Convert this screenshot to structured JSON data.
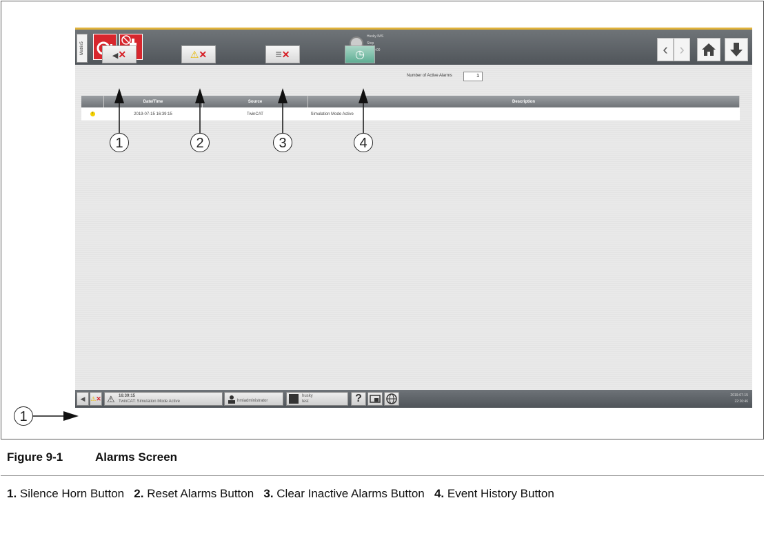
{
  "hmi": {
    "side_tab": "Matrix5",
    "status_lines": [
      "Husky IMS",
      "Stop",
      "00:00:00"
    ],
    "status_unit": "°C",
    "nav": {
      "back": "‹",
      "forward": "›"
    },
    "toolbar": {
      "silence_glyph": "◀",
      "x_glyph": "✕",
      "warn_glyph": "⚠",
      "list_glyph": "≡",
      "history_glyph": "◷",
      "active_alarms_label": "Number of Active Alarms",
      "active_alarms_value": "1"
    },
    "table": {
      "headers": [
        "",
        "Date/Time",
        "Source",
        "Description"
      ],
      "rows": [
        {
          "icon": "!",
          "datetime": "2019-07-15 16:39:15",
          "source": "TwinCAT",
          "description": "Simulation Mode Active"
        }
      ]
    },
    "bottom": {
      "alarm_time": "16:39:15",
      "alarm_text": "TwinCAT: Simulation Mode Active",
      "user": "hmiadministrator",
      "mold_name": "husky",
      "mold_sub": "test",
      "help": "?",
      "date": "2019-07-15",
      "time": "22:26:46"
    }
  },
  "callouts": [
    "1",
    "2",
    "3",
    "4"
  ],
  "bottom_callout": "1",
  "figure": {
    "number": "Figure 9-1",
    "title": "Alarms Screen"
  },
  "legend": [
    {
      "num": "1.",
      "text": "Silence Horn Button"
    },
    {
      "num": "2.",
      "text": "Reset Alarms Button"
    },
    {
      "num": "3.",
      "text": "Clear Inactive Alarms Button"
    },
    {
      "num": "4.",
      "text": "Event History Button"
    }
  ]
}
